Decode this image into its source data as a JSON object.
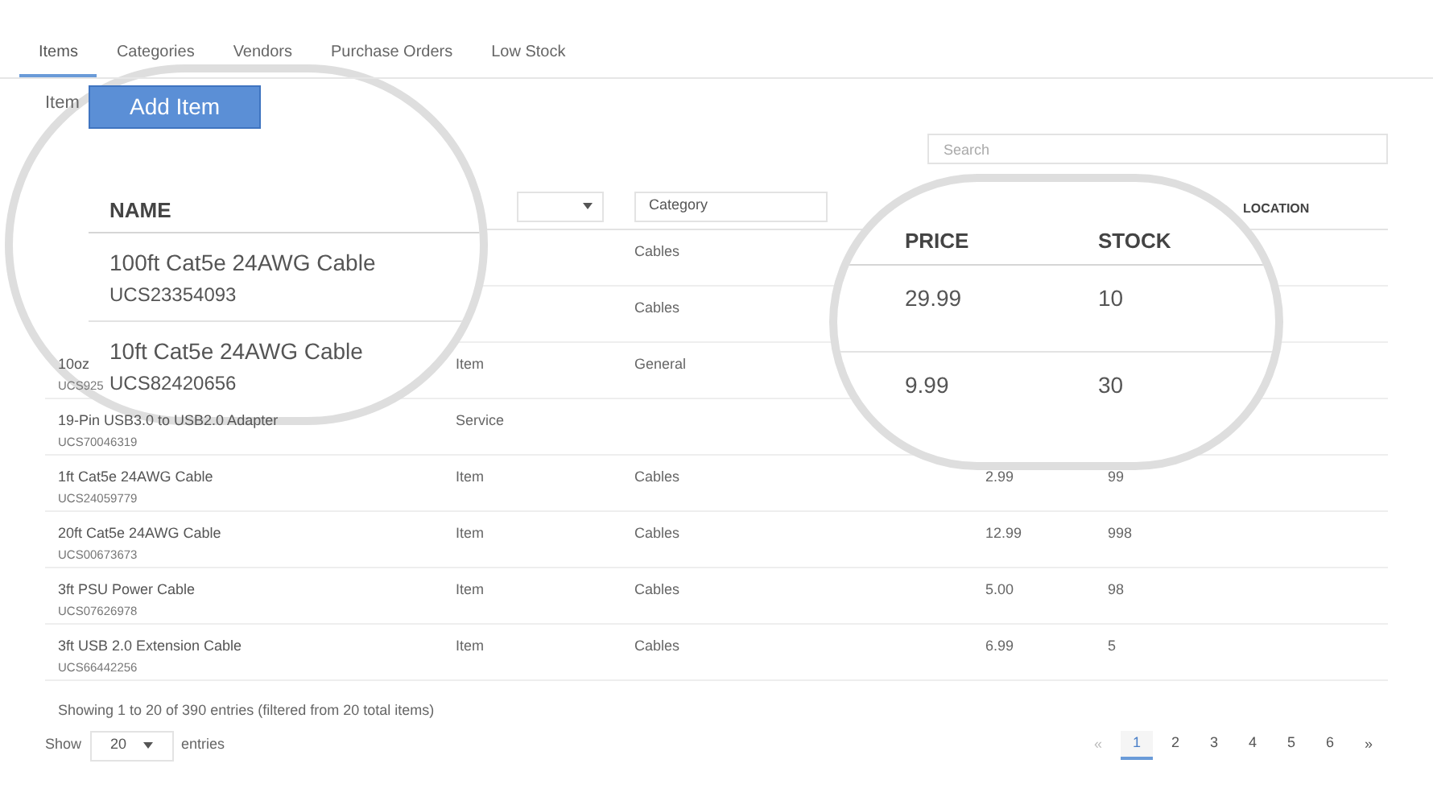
{
  "tabs": [
    {
      "label": "Items",
      "selected": true
    },
    {
      "label": "Categories",
      "selected": false
    },
    {
      "label": "Vendors",
      "selected": false
    },
    {
      "label": "Purchase Orders",
      "selected": false
    },
    {
      "label": "Low Stock",
      "selected": false
    }
  ],
  "section_label": "Item",
  "search": {
    "placeholder": "Search"
  },
  "filters": {
    "category": {
      "placeholder": "Category"
    }
  },
  "table": {
    "columns": {
      "location": "LOCATION"
    },
    "rows": [
      {
        "category": "Cables"
      },
      {
        "category": "Cables"
      },
      {
        "name": "10oz",
        "sku": "UCS925",
        "type": "Item",
        "category": "General"
      },
      {
        "name": "19-Pin USB3.0 to USB2.0 Adapter",
        "sku": "UCS70046319",
        "type": "Service"
      },
      {
        "name": "1ft Cat5e 24AWG Cable",
        "sku": "UCS24059779",
        "type": "Item",
        "category": "Cables",
        "price": "2.99",
        "stock": "99"
      },
      {
        "name": "20ft Cat5e 24AWG Cable",
        "sku": "UCS00673673",
        "type": "Item",
        "category": "Cables",
        "price": "12.99",
        "stock": "998"
      },
      {
        "name": "3ft PSU Power Cable",
        "sku": "UCS07626978",
        "type": "Item",
        "category": "Cables",
        "price": "5.00",
        "stock": "98"
      },
      {
        "name": "3ft USB 2.0 Extension Cable",
        "sku": "UCS66442256",
        "type": "Item",
        "category": "Cables",
        "price": "6.99",
        "stock": "5"
      }
    ]
  },
  "summary": "Showing 1 to 20 of 390 entries (filtered from 20 total items)",
  "page_size": {
    "label_before": "Show",
    "value": "20",
    "label_after": "entries"
  },
  "pagination": {
    "first": "«",
    "last": "»",
    "pages": [
      {
        "label": "1",
        "selected": true
      },
      {
        "label": "2",
        "selected": false
      },
      {
        "label": "3",
        "selected": false
      },
      {
        "label": "4",
        "selected": false
      },
      {
        "label": "5",
        "selected": false
      },
      {
        "label": "6",
        "selected": false
      }
    ]
  },
  "magnifier_left": {
    "button": "Add Item",
    "header": "NAME",
    "rows": [
      {
        "name": "100ft Cat5e 24AWG Cable",
        "sku": "UCS23354093"
      },
      {
        "name": "10ft Cat5e 24AWG Cable",
        "sku": "UCS82420656"
      }
    ]
  },
  "magnifier_right": {
    "headers": [
      "PRICE",
      "STOCK"
    ],
    "rows": [
      {
        "price": "29.99",
        "stock": "10"
      },
      {
        "price": "9.99",
        "stock": "30"
      }
    ]
  }
}
